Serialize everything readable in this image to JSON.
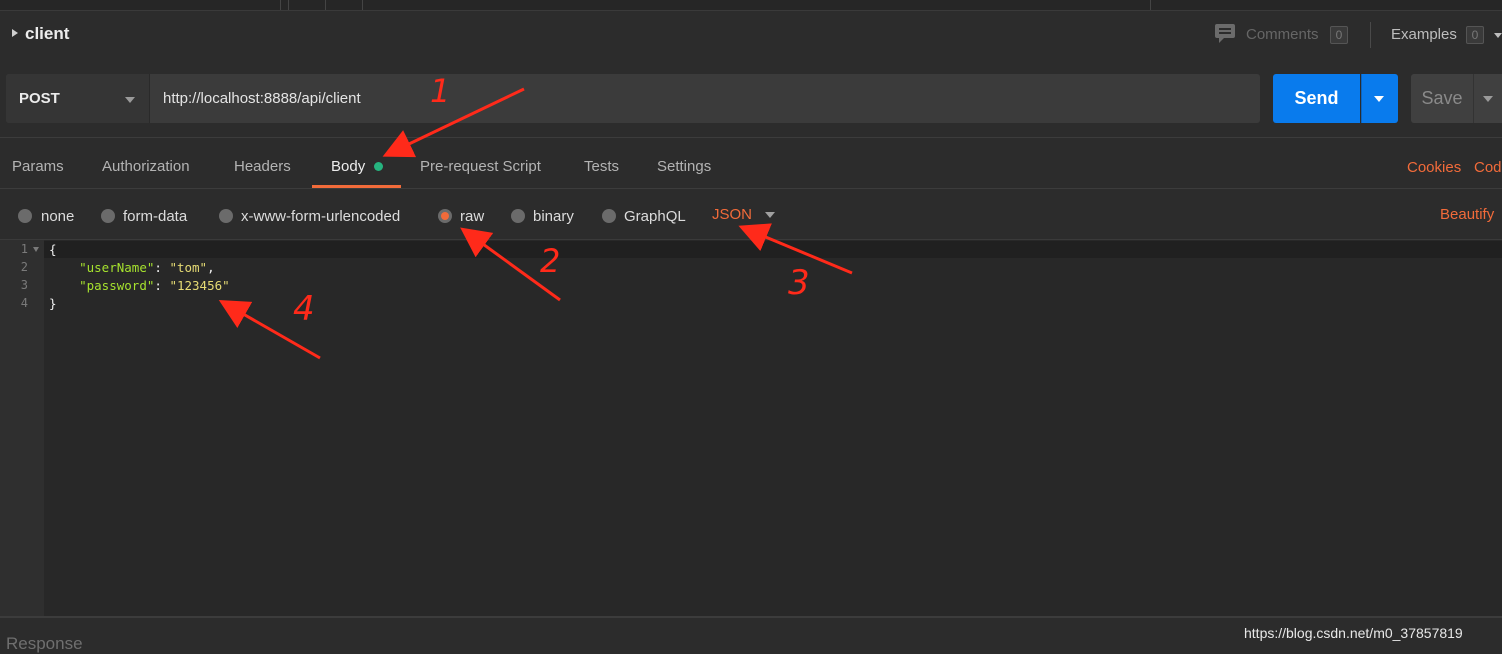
{
  "request": {
    "name": "client",
    "comments_label": "Comments",
    "comments_count": "0",
    "examples_label": "Examples",
    "examples_count": "0",
    "method": "POST",
    "url": "http://localhost:8888/api/client",
    "send_label": "Send",
    "save_label": "Save"
  },
  "tabs": [
    {
      "label": "Params"
    },
    {
      "label": "Authorization"
    },
    {
      "label": "Headers"
    },
    {
      "label": "Body",
      "active": true
    },
    {
      "label": "Pre-request Script"
    },
    {
      "label": "Tests"
    },
    {
      "label": "Settings"
    }
  ],
  "right_links": {
    "cookies": "Cookies",
    "code": "Cod"
  },
  "body_options": [
    {
      "label": "none"
    },
    {
      "label": "form-data"
    },
    {
      "label": "x-www-form-urlencoded"
    },
    {
      "label": "raw",
      "selected": true
    },
    {
      "label": "binary"
    },
    {
      "label": "GraphQL"
    }
  ],
  "raw_format": "JSON",
  "beautify_label": "Beautify",
  "editor": {
    "line_numbers": [
      "1",
      "2",
      "3",
      "4"
    ],
    "lines": [
      {
        "text": "{"
      },
      {
        "indent": "    ",
        "key": "\"userName\"",
        "sep": ": ",
        "value": "\"tom\"",
        "tail": ","
      },
      {
        "indent": "    ",
        "key": "\"password\"",
        "sep": ": ",
        "value": "\"123456\"",
        "tail": ""
      },
      {
        "text": "}"
      }
    ]
  },
  "annotations": [
    "1",
    "2",
    "3",
    "4"
  ],
  "response_label": "Response",
  "watermark": "https://blog.csdn.net/m0_37857819",
  "colors": {
    "accent": "#f26b3a",
    "send": "#097bed",
    "status_dot": "#26b47f",
    "json_key": "#a6e22e",
    "json_string": "#e6db74",
    "annotation": "#ff2a1a"
  }
}
